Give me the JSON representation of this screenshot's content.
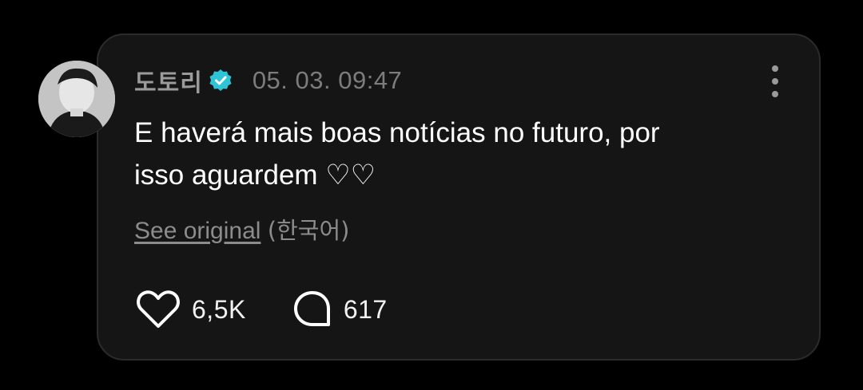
{
  "post": {
    "author": "도토리",
    "verified_icon": "verified-badge-icon",
    "timestamp": "05. 03. 09:47",
    "text_line1": "E haverá mais boas notícias no futuro, por",
    "text_line2": "isso aguardem ♡♡",
    "see_original": "See original",
    "original_language": "(한국어)",
    "likes": "6,5K",
    "comments": "617"
  },
  "colors": {
    "background": "#000000",
    "card": "#151515",
    "verified": "#2ec4d6",
    "text": "#ffffff",
    "muted": "#8c8c8c"
  },
  "icons": {
    "like": "heart-outline-icon",
    "comment": "speech-bubble-icon",
    "more": "vertical-dots-icon"
  }
}
